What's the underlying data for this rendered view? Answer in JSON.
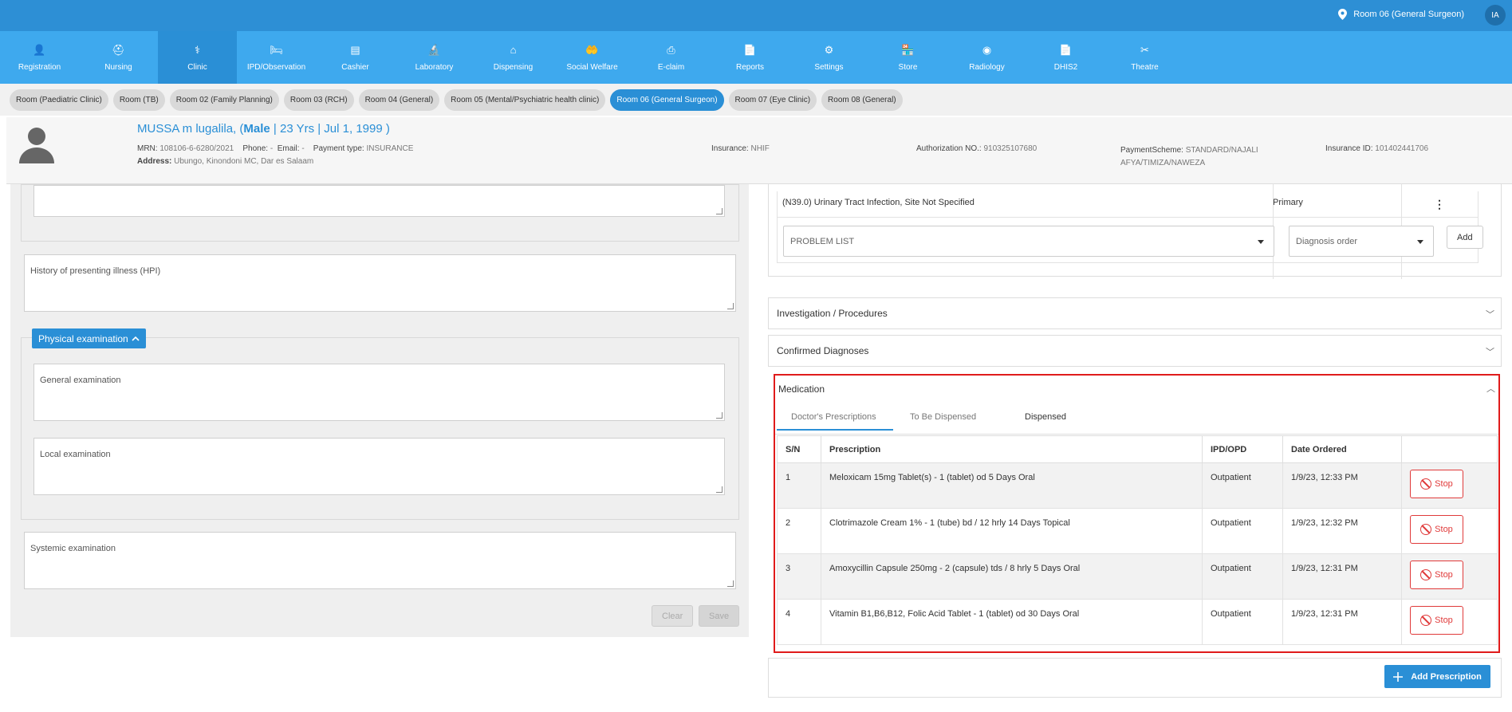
{
  "topbar": {
    "location": "Room 06 (General Surgeon)",
    "user_initials": "IA"
  },
  "nav": [
    {
      "label": "Registration",
      "icon": "user-add-icon"
    },
    {
      "label": "Nursing",
      "icon": "nurse-icon"
    },
    {
      "label": "Clinic",
      "icon": "doctor-icon",
      "active": true
    },
    {
      "label": "IPD/Observation",
      "icon": "bed-icon"
    },
    {
      "label": "Cashier",
      "icon": "register-icon"
    },
    {
      "label": "Laboratory",
      "icon": "microscope-icon"
    },
    {
      "label": "Dispensing",
      "icon": "pharmacy-icon"
    },
    {
      "label": "Social Welfare",
      "icon": "hands-icon"
    },
    {
      "label": "E-claim",
      "icon": "printer-icon"
    },
    {
      "label": "Reports",
      "icon": "report-icon"
    },
    {
      "label": "Settings",
      "icon": "gear-icon"
    },
    {
      "label": "Store",
      "icon": "store-icon"
    },
    {
      "label": "Radiology",
      "icon": "radiation-icon"
    },
    {
      "label": "DHIS2",
      "icon": "document-icon"
    },
    {
      "label": "Theatre",
      "icon": "scissors-icon"
    }
  ],
  "rooms": [
    {
      "label": "Room (Paediatric Clinic)"
    },
    {
      "label": "Room (TB)"
    },
    {
      "label": "Room 02 (Family Planning)"
    },
    {
      "label": "Room 03 (RCH)"
    },
    {
      "label": "Room 04 (General)"
    },
    {
      "label": "Room 05 (Mental/Psychiatric health clinic)"
    },
    {
      "label": "Room 06 (General Surgeon)",
      "active": true
    },
    {
      "label": "Room 07 (Eye Clinic)"
    },
    {
      "label": "Room 08 (General)"
    }
  ],
  "patient": {
    "name": "MUSSA m lugalila,",
    "name_open": "(",
    "gender": "Male",
    "age_dob": " | 23 Yrs | Jul 1, 1999 )",
    "mrn_label": "MRN:",
    "mrn": "108106-6-6280/2021",
    "phone_label": "Phone:",
    "phone": "-",
    "email_label": "Email:",
    "email": "-",
    "payment_label": "Payment type:",
    "payment": "INSURANCE",
    "address_label": "Address:",
    "address": "Ubungo, Kinondoni MC, Dar es Salaam",
    "insurance_label": "Insurance:",
    "insurance": "NHIF",
    "auth_label": "Authorization NO.:",
    "auth": "910325107680",
    "scheme_label": "PaymentScheme:",
    "scheme_line1": "STANDARD/NAJALI",
    "scheme_line2": "AFYA/TIMIZA/NAWEZA",
    "insurance_id_label": "Insurance ID:",
    "insurance_id": "101402441706"
  },
  "left": {
    "hpi_placeholder": "History of presenting illness (HPI)",
    "pe_label": "Physical examination",
    "general_placeholder": "General examination",
    "local_placeholder": "Local examination",
    "systemic_placeholder": "Systemic examination",
    "clear_label": "Clear",
    "save_label": "Save"
  },
  "diagnosis": {
    "row_text": "(N39.0) Urinary Tract Infection, Site Not Specified",
    "row_order": "Primary",
    "problem_list_placeholder": "PROBLEM LIST",
    "order_placeholder": "Diagnosis order",
    "add_label": "Add"
  },
  "sections": {
    "investigation": "Investigation / Procedures",
    "confirmed": "Confirmed Diagnoses",
    "medication": "Medication"
  },
  "medication": {
    "tabs": [
      "Doctor's Prescriptions",
      "To Be Dispensed",
      "Dispensed"
    ],
    "columns": [
      "S/N",
      "Prescription",
      "IPD/OPD",
      "Date Ordered",
      ""
    ],
    "rows": [
      {
        "sn": "1",
        "rx": "Meloxicam 15mg Tablet(s) - 1 (tablet) od 5 Days Oral",
        "type": "Outpatient",
        "date": "1/9/23, 12:33 PM",
        "action": "Stop"
      },
      {
        "sn": "2",
        "rx": "Clotrimazole Cream 1% - 1 (tube) bd / 12 hrly 14 Days Topical",
        "type": "Outpatient",
        "date": "1/9/23, 12:32 PM",
        "action": "Stop"
      },
      {
        "sn": "3",
        "rx": "Amoxycillin Capsule 250mg - 2 (capsule) tds / 8 hrly 5 Days Oral",
        "type": "Outpatient",
        "date": "1/9/23, 12:31 PM",
        "action": "Stop"
      },
      {
        "sn": "4",
        "rx": "Vitamin B1,B6,B12, Folic Acid Tablet - 1 (tablet) od 30 Days Oral",
        "type": "Outpatient",
        "date": "1/9/23, 12:31 PM",
        "action": "Stop"
      }
    ],
    "add_prescription_label": "Add Prescription"
  },
  "colors": {
    "topbar": "#2d8fd5",
    "navbar": "#3ea9ee",
    "accent": "#2a8fd6",
    "danger": "#e01b1b"
  }
}
